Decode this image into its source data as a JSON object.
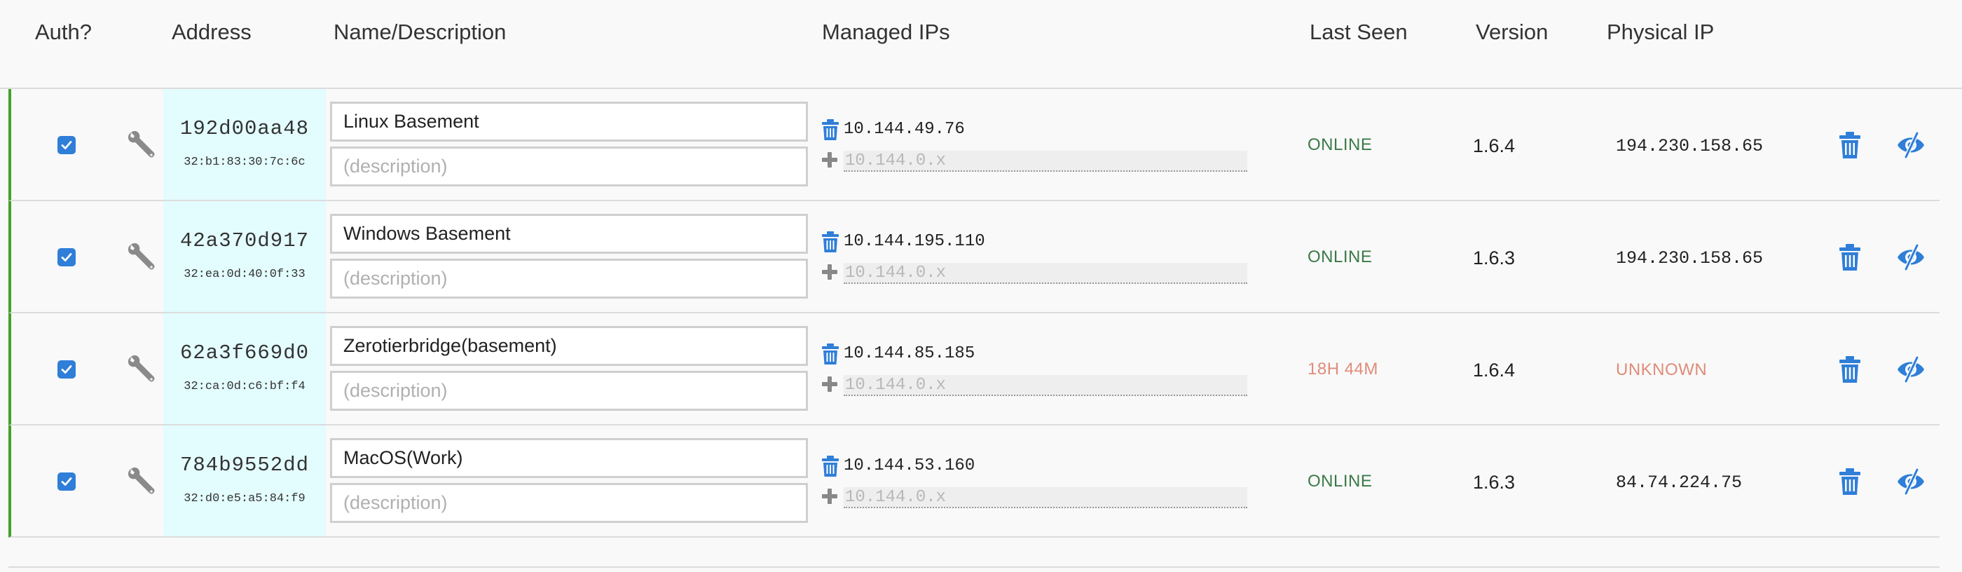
{
  "header": {
    "auth": "Auth?",
    "address": "Address",
    "name": "Name/Description",
    "managed_ips": "Managed IPs",
    "last_seen": "Last Seen",
    "version": "Version",
    "physical_ip": "Physical IP"
  },
  "colors": {
    "online": "#3a7a48",
    "unknown": "#e08c7a",
    "accent": "#2f7ed8",
    "row_border": "#42a228",
    "address_bg": "#e3fcfe"
  },
  "members": [
    {
      "authorized": true,
      "address": "192d00aa48",
      "mac": "32:b1:83:30:7c:6c",
      "name": "Linux Basement",
      "description_placeholder": "(description)",
      "ip": "10.144.49.76",
      "ip_placeholder": "10.144.0.x",
      "last_seen": "ONLINE",
      "status": "online",
      "version": "1.6.4",
      "physical_ip": "194.230.158.65"
    },
    {
      "authorized": true,
      "address": "42a370d917",
      "mac": "32:ea:0d:40:0f:33",
      "name": "Windows Basement",
      "description_placeholder": "(description)",
      "ip": "10.144.195.110",
      "ip_placeholder": "10.144.0.x",
      "last_seen": "ONLINE",
      "status": "online",
      "version": "1.6.3",
      "physical_ip": "194.230.158.65"
    },
    {
      "authorized": true,
      "address": "62a3f669d0",
      "mac": "32:ca:0d:c6:bf:f4",
      "name": "Zerotierbridge(basement)",
      "description_placeholder": "(description)",
      "ip": "10.144.85.185",
      "ip_placeholder": "10.144.0.x",
      "last_seen": "18H 44M",
      "status": "unknown",
      "version": "1.6.4",
      "physical_ip": "UNKNOWN"
    },
    {
      "authorized": true,
      "address": "784b9552dd",
      "mac": "32:d0:e5:a5:84:f9",
      "name": "MacOS(Work)",
      "description_placeholder": "(description)",
      "ip": "10.144.53.160",
      "ip_placeholder": "10.144.0.x",
      "last_seen": "ONLINE",
      "status": "online",
      "version": "1.6.3",
      "physical_ip": "84.74.224.75"
    }
  ]
}
